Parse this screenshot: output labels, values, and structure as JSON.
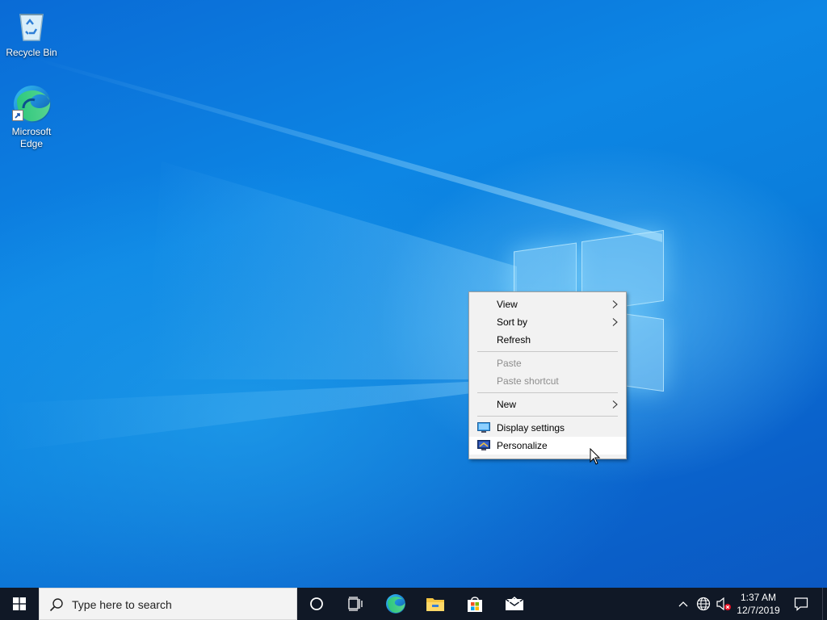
{
  "desktop": {
    "icons": [
      {
        "label": "Recycle Bin"
      },
      {
        "label": "Microsoft Edge"
      }
    ]
  },
  "context_menu": {
    "items": [
      {
        "label": "View",
        "has_submenu": true,
        "enabled": true
      },
      {
        "label": "Sort by",
        "has_submenu": true,
        "enabled": true
      },
      {
        "label": "Refresh",
        "enabled": true
      },
      {
        "label": "Paste",
        "enabled": false
      },
      {
        "label": "Paste shortcut",
        "enabled": false
      },
      {
        "label": "New",
        "has_submenu": true,
        "enabled": true
      },
      {
        "label": "Display settings",
        "icon": "display-icon",
        "enabled": true
      },
      {
        "label": "Personalize",
        "icon": "personalize-icon",
        "enabled": true,
        "hovered": true
      }
    ]
  },
  "taskbar": {
    "search_placeholder": "Type here to search",
    "pinned": [
      "cortana-icon",
      "task-view-icon",
      "edge-icon",
      "file-explorer-icon",
      "store-icon",
      "mail-icon"
    ],
    "tray": [
      "show-hidden-icons-icon",
      "network-icon",
      "volume-muted-icon"
    ],
    "clock": {
      "time": "1:37 AM",
      "date": "12/7/2019"
    }
  },
  "colors": {
    "taskbar": "#101826",
    "menu_bg": "#f2f2f2",
    "wallpaper_accent": "#0a6bd6"
  }
}
